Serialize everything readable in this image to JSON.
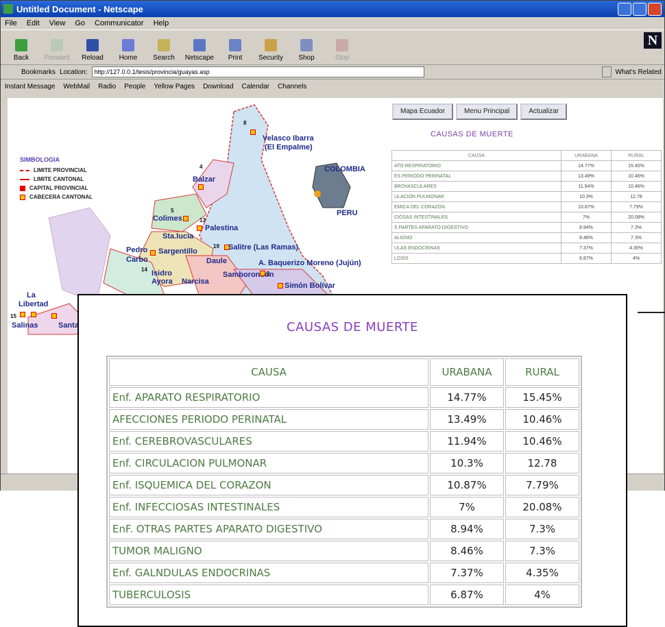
{
  "window": {
    "title": "Untitled Document - Netscape",
    "menu": [
      "File",
      "Edit",
      "View",
      "Go",
      "Communicator",
      "Help"
    ],
    "toolbar": [
      {
        "label": "Back",
        "icon": "back-icon",
        "disabled": false
      },
      {
        "label": "Forward",
        "icon": "forward-icon",
        "disabled": true
      },
      {
        "label": "Reload",
        "icon": "reload-icon",
        "disabled": false
      },
      {
        "label": "Home",
        "icon": "home-icon",
        "disabled": false
      },
      {
        "label": "Search",
        "icon": "search-icon",
        "disabled": false
      },
      {
        "label": "Netscape",
        "icon": "netscape-icon",
        "disabled": false
      },
      {
        "label": "Print",
        "icon": "print-icon",
        "disabled": false
      },
      {
        "label": "Security",
        "icon": "security-icon",
        "disabled": false
      },
      {
        "label": "Shop",
        "icon": "shop-icon",
        "disabled": false
      },
      {
        "label": "Stop",
        "icon": "stop-icon",
        "disabled": true
      }
    ],
    "bookmarks_label": "Bookmarks",
    "location_label": "Location:",
    "url": "http://127.0.0.1/tesis/provincia/guayas.asp",
    "whats_related": "What's Related",
    "personal_toolbar": [
      "Instant Message",
      "WebMail",
      "Radio",
      "People",
      "Yellow Pages",
      "Download",
      "Calendar",
      "Channels"
    ]
  },
  "map": {
    "legend_title": "SIMBOLOGIA",
    "legend": [
      "LIMITE PROVINCIAL",
      "LIMITE CANTONAL",
      "CAPITAL PROVINCIAL",
      "CABECERA CANTONAL"
    ],
    "labels": {
      "velasco": "Velasco Ibarra",
      "empalme": "(El Empalme)",
      "balzar": "Balzar",
      "colimes": "Colimes",
      "palestina": "Palestina",
      "colombia": "COLOMBIA",
      "peru": "PERU",
      "sta_lucia": "Sta.lucia",
      "pedro": "Pedro",
      "carbo": "Carbo",
      "sargentillo": "Sargentillo",
      "daule": "Daule",
      "salitre": "Salitre (Las Ramas)",
      "isidro": "Isidro",
      "ayora": "Ayora",
      "narcisa": "Narcisa",
      "samborondon": "Samborondón",
      "moreno": "A. Baquerizo Moreno (Jujún)",
      "simon": "Simón Bolívar",
      "libertad_1": "La",
      "libertad_2": "Libertad",
      "salinas": "Salinas",
      "santa": "Santa"
    },
    "numbers": [
      "8",
      "4",
      "5",
      "13",
      "19",
      "14",
      "2",
      "15"
    ]
  },
  "nav": {
    "mapa": "Mapa Ecuador",
    "menu": "Menu Principal",
    "actualizar": "Actualizar"
  },
  "table": {
    "title": "CAUSAS DE MUERTE",
    "headers": [
      "CAUSA",
      "URABANA",
      "RURAL"
    ],
    "rows": [
      {
        "causa": "Enf. APARATO RESPIRATORIO",
        "urbana": "14.77%",
        "rural": "15.45%"
      },
      {
        "causa": "AFECCIONES PERIODO PERINATAL",
        "urbana": "13.49%",
        "rural": "10.46%"
      },
      {
        "causa": "Enf. CEREBROVASCULARES",
        "urbana": "11.94%",
        "rural": "10.46%"
      },
      {
        "causa": "Enf. CIRCULACION PULMONAR",
        "urbana": "10.3%",
        "rural": "12.78"
      },
      {
        "causa": "Enf. ISQUEMICA DEL CORAZON",
        "urbana": "10.87%",
        "rural": "7.79%"
      },
      {
        "causa": "Enf. INFECCIOSAS INTESTINALES",
        "urbana": "7%",
        "rural": "20.08%"
      },
      {
        "causa": "EnF. OTRAS PARTES APARATO DIGESTIVO",
        "urbana": "8.94%",
        "rural": "7.3%"
      },
      {
        "causa": "TUMOR MALIGNO",
        "urbana": "8.46%",
        "rural": "7.3%"
      },
      {
        "causa": "Enf. GALNDULAS ENDOCRINAS",
        "urbana": "7.37%",
        "rural": "4.35%"
      },
      {
        "causa": "TUBERCULOSIS",
        "urbana": "6.87%",
        "rural": "4%"
      }
    ],
    "small_rows": [
      {
        "causa": "ATO RESPIRATORIO",
        "urbana": "14.77%",
        "rural": "15.45%"
      },
      {
        "causa": "ES PERIODO PERINATAL",
        "urbana": "13.49%",
        "rural": "10.46%"
      },
      {
        "causa": "BROVASCULARES",
        "urbana": "11.94%",
        "rural": "10.46%"
      },
      {
        "causa": "ULACION PULMONAR",
        "urbana": "10.3%",
        "rural": "12.78"
      },
      {
        "causa": "EMICA DEL CORAZON",
        "urbana": "10.87%",
        "rural": "7.79%"
      },
      {
        "causa": "CIOSAS INTESTINALES",
        "urbana": "7%",
        "rural": "20.08%"
      },
      {
        "causa": "S PARTES APARATO DIGESTIVO",
        "urbana": "8.94%",
        "rural": "7.3%"
      },
      {
        "causa": "ALIGNO",
        "urbana": "8.46%",
        "rural": "7.3%"
      },
      {
        "causa": "ULAS ENDOCRINAS",
        "urbana": "7.37%",
        "rural": "4.35%"
      },
      {
        "causa": "LOSIS",
        "urbana": "6.87%",
        "rural": "4%"
      }
    ]
  }
}
